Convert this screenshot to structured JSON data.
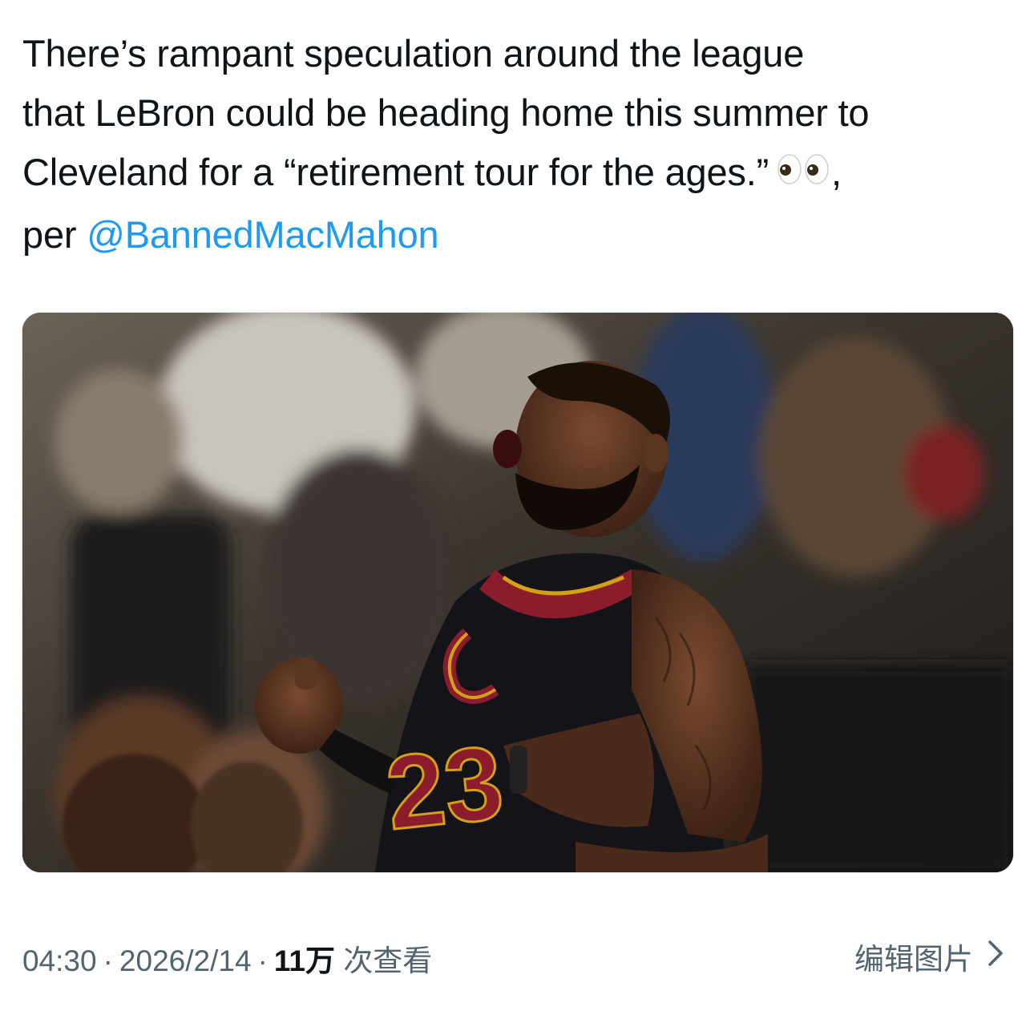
{
  "tweet": {
    "text_line_1": "There’s rampant speculation around the league",
    "text_line_2": "that LeBron could be heading home this summer to",
    "text_line_3_a": "Cleveland for a “retirement tour for the ages.”",
    "text_line_3_b": ",",
    "text_line_4_a": "per ",
    "mention": "@BannedMacMahon",
    "emoji_icon": "eyes-emoji-icon"
  },
  "media": {
    "jersey_number": "23"
  },
  "meta": {
    "time": "04:30",
    "date": "2026/2/14",
    "views_count": "11万",
    "views_label": "次查看",
    "separator": "·"
  },
  "edit_image": {
    "label": "编辑图片",
    "icon": "chevron-right-icon"
  },
  "colors": {
    "text": "#0f1419",
    "secondary": "#536471",
    "link": "#1d9bf0"
  }
}
